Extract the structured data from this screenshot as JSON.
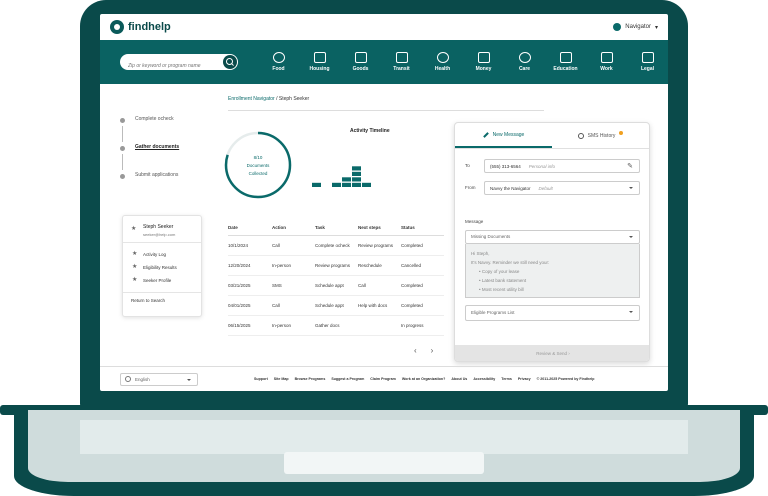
{
  "app": {
    "brand": "findhelp",
    "user_menu": "Navigator"
  },
  "search": {
    "placeholder": "Zip or keyword or program name"
  },
  "categories": [
    "Food",
    "Housing",
    "Goods",
    "Transit",
    "Health",
    "Money",
    "Care",
    "Education",
    "Work",
    "Legal"
  ],
  "breadcrumb": {
    "parent": "Enrollment Navigator",
    "separator": " / ",
    "current": "Steph Seeker"
  },
  "steps": [
    {
      "label": "Complete ocheck"
    },
    {
      "label": "Gather documents"
    },
    {
      "label": "Submit applications"
    }
  ],
  "progress": {
    "line1": "8/10",
    "line2": "Documents",
    "line3": "Collected",
    "collected": 8,
    "total": 10
  },
  "chart_data": {
    "type": "bar",
    "title": "Activity Timeline",
    "categories": [
      "1",
      "2",
      "3",
      "4",
      "5",
      "6",
      "7"
    ],
    "values": [
      1,
      0,
      1,
      2,
      4,
      1,
      0
    ],
    "ylim": [
      0,
      4
    ],
    "grid": false,
    "color": "#0a6a6a"
  },
  "seeker": {
    "name": "Steph Seeker",
    "email": "seeker@help.com",
    "links": [
      "Activity Log",
      "Eligibility Results",
      "Seeker Profile"
    ],
    "return": "Return to Search"
  },
  "table": {
    "headers": [
      "Date",
      "Action",
      "Task",
      "Next steps",
      "Status"
    ],
    "rows": [
      [
        "10/1/2024",
        "Call",
        "Complete ocheck",
        "Review programs",
        "Completed"
      ],
      [
        "12/20/2024",
        "In-person",
        "Review programs",
        "Reschedule",
        "Cancelled"
      ],
      [
        "03/21/2025",
        "SMS",
        "Schedule appt",
        "Call",
        "Completed"
      ],
      [
        "04/01/2025",
        "Call",
        "Schedule appt",
        "Help with docs",
        "Completed"
      ],
      [
        "06/15/2025",
        "In-person",
        "Gather docs",
        "",
        "In progress"
      ]
    ]
  },
  "pager": {
    "prev": "‹",
    "next": "›"
  },
  "message": {
    "tab_new": "New Message",
    "tab_history": "SMS History",
    "to_label": "To",
    "to_value": "(555) 313-6564",
    "to_hint": "Personal info",
    "from_label": "From",
    "from_value": "Navvy the Navigator",
    "from_hint": "Default",
    "message_label": "Message",
    "template": "Missing Documents",
    "body_greeting": "Hi Steph,",
    "body_intro": "It's Navvy. Reminder we still need your:",
    "body_items": [
      "Copy of your lease",
      "Latest bank statement",
      "Most recent utility bill"
    ],
    "eligible": "Eligible Programs List",
    "send": "Review & Send"
  },
  "footer": {
    "language": "English",
    "links": [
      "Support",
      "Site Map",
      "Browse Programs",
      "Suggest a Program",
      "Claim Program",
      "Work at an Organization?",
      "About Us",
      "Accessibility",
      "Terms",
      "Privacy",
      "© 2011-2025 Powered by Findhelp"
    ]
  },
  "colors": {
    "frame": "#0a4a4a",
    "accent": "#0a6262",
    "badge": "#f0a020"
  }
}
